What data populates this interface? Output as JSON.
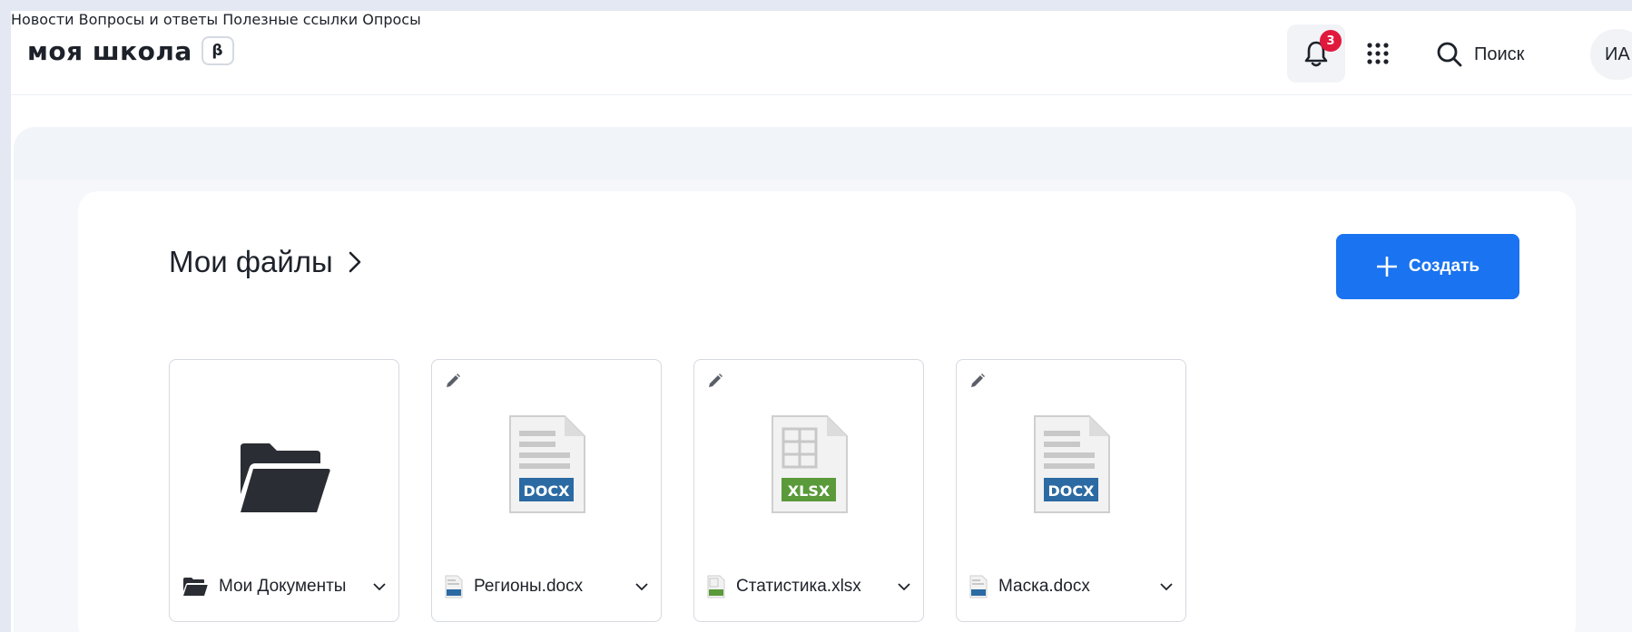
{
  "header": {
    "logo_text": "моя школа",
    "beta_label": "β",
    "nav": [
      {
        "label": "Новости"
      },
      {
        "label": "Вопросы и ответы"
      },
      {
        "label": "Полезные ссылки"
      },
      {
        "label": "Опросы"
      }
    ],
    "notifications_count": "3",
    "search_label": "Поиск",
    "avatar_initials": "ИА"
  },
  "files": {
    "title": "Мои файлы",
    "create_label": "Создать",
    "items": [
      {
        "name": "Мои Документы",
        "type": "folder",
        "icon": "folder-icon"
      },
      {
        "name": "Регионы.docx",
        "type": "docx",
        "icon": "docx-file-icon",
        "badge": "DOCX"
      },
      {
        "name": "Статистика.xlsx",
        "type": "xlsx",
        "icon": "xlsx-file-icon",
        "badge": "XLSX"
      },
      {
        "name": "Маска.docx",
        "type": "docx",
        "icon": "docx-file-icon",
        "badge": "DOCX"
      }
    ]
  },
  "colors": {
    "accent": "#1a73f0",
    "badge": "#e0183c",
    "docx": "#2b6aa3",
    "xlsx": "#5a9a3a"
  }
}
